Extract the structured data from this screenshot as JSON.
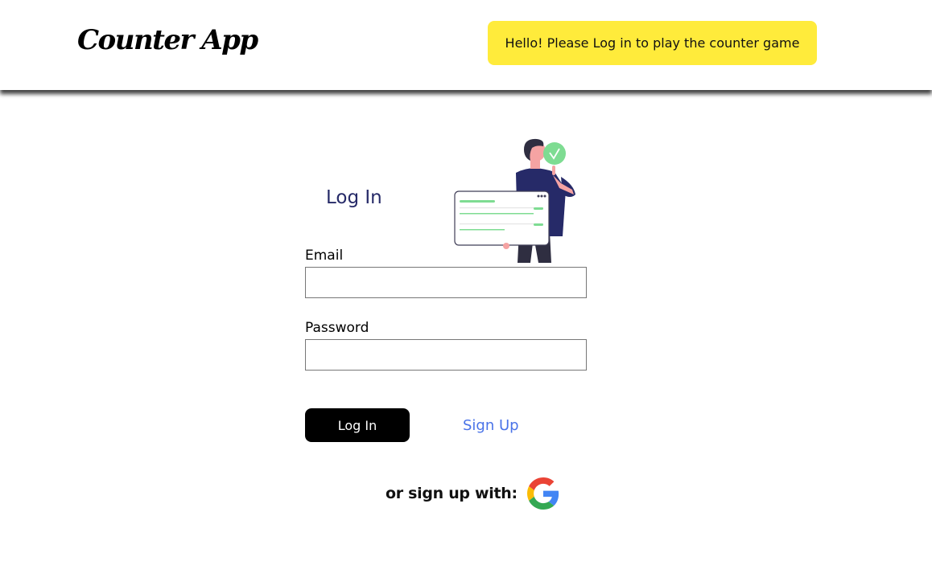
{
  "header": {
    "logo": "Counter App",
    "banner_text": "Hello! Please Log in to play the counter game"
  },
  "login": {
    "title": "Log In",
    "email_label": "Email",
    "email_value": "",
    "password_label": "Password",
    "password_value": "",
    "submit_label": "Log In",
    "signup_label": "Sign Up",
    "alt_text": "or sign up with:",
    "alt_provider_icon": "google-icon",
    "illustration_icon": "person-with-checklist-illustration"
  },
  "colors": {
    "banner": "#ffeb3b",
    "title": "#262a68",
    "link": "#4a73e8",
    "button": "#000000",
    "accent_green": "#7edc92"
  }
}
